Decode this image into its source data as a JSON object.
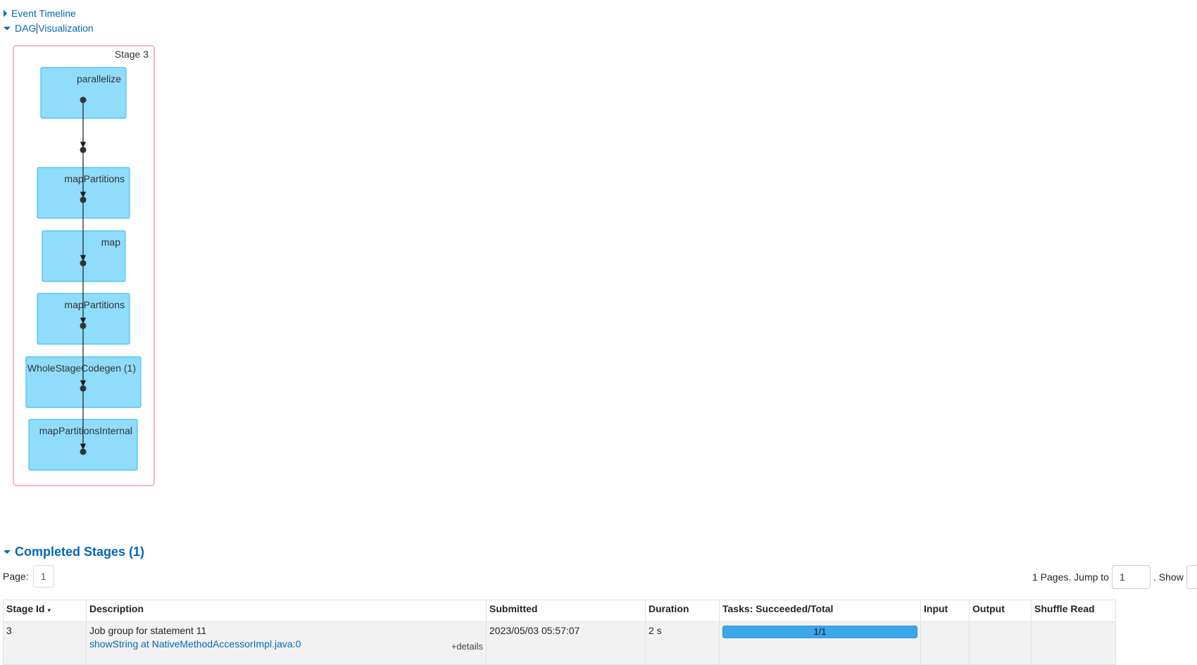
{
  "toggles": {
    "event_timeline": "Event Timeline",
    "dag_prefix": "DAG",
    "dag_suffix": "Visualization"
  },
  "dag": {
    "stage_label": "Stage 3",
    "nodes": [
      {
        "name": "parallelize"
      },
      {
        "name": "mapPartitions"
      },
      {
        "name": "map"
      },
      {
        "name": "mapPartitions"
      },
      {
        "name": "WholeStageCodegen (1)"
      },
      {
        "name": "mapPartitionsInternal"
      }
    ],
    "colors": {
      "cluster_border": "#f7a1b0",
      "node_fill": "#8fdcfb",
      "node_border": "#45c0ef"
    }
  },
  "completed_stages": {
    "title": "Completed Stages (1)",
    "page_label": "Page:",
    "current_page": "1",
    "pages_text": "1 Pages. Jump to",
    "jump_value": "1",
    "show_text": ". Show",
    "columns": [
      "Stage Id",
      "Description",
      "Submitted",
      "Duration",
      "Tasks: Succeeded/Total",
      "Input",
      "Output",
      "Shuffle Read"
    ],
    "rows": [
      {
        "stage_id": "3",
        "description": "Job group for statement 11",
        "description_link": "showString at NativeMethodAccessorImpl.java:0",
        "details": "+details",
        "submitted": "2023/05/03 05:57:07",
        "duration": "2 s",
        "tasks_text": "1/1",
        "tasks_fraction": 1.0,
        "input": "",
        "output": "",
        "shuffle_read": ""
      }
    ]
  }
}
